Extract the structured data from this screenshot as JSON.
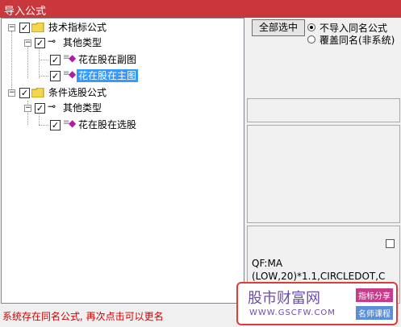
{
  "window": {
    "title": "导入公式"
  },
  "tree": {
    "root1": "技术指标公式",
    "child1": "其他类型",
    "leaf1": "花在股在副图",
    "leaf2": "花在股在主图",
    "root2": "条件选股公式",
    "child2": "其他类型",
    "leaf3": "花在股在选股"
  },
  "options": {
    "select_all": "全部选中",
    "radio1": "不导入同名公式",
    "radio2": "覆盖同名(非系统)"
  },
  "formula": {
    "line1": "QF:MA",
    "line2": "(LOW,20)*1.1,CIRCLEDOT,C"
  },
  "status": "系统存在同名公式, 再次点击可以更名",
  "watermark": {
    "title": "股市财富网",
    "url": "WWW.GSCFW.COM",
    "tag1": "指标分享",
    "tag2": "名师课程"
  },
  "colors": {
    "title_bar": "#c8373c",
    "selection": "#3399ff",
    "status_text": "#d10000"
  }
}
